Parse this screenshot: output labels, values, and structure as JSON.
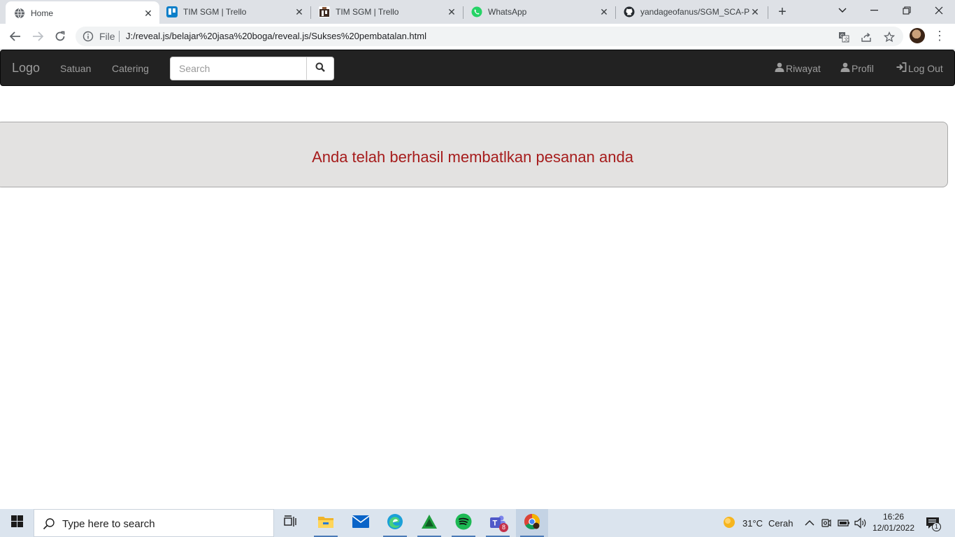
{
  "browser": {
    "tabs": [
      {
        "title": "Home",
        "icon": "globe-icon",
        "active": true
      },
      {
        "title": "TIM SGM | Trello",
        "icon": "trello-icon",
        "active": false
      },
      {
        "title": "TIM SGM | Trello",
        "icon": "trello-icon",
        "active": false
      },
      {
        "title": "WhatsApp",
        "icon": "whatsapp-icon",
        "active": false
      },
      {
        "title": "yandageofanus/SGM_SCA-Pa",
        "icon": "github-icon",
        "active": false
      }
    ],
    "address": {
      "scheme_label": "File",
      "url": "J:/reveal.js/belajar%20jasa%20boga/reveal.js/Sukses%20pembatalan.html"
    }
  },
  "navbar": {
    "brand": "Logo",
    "links": [
      "Satuan",
      "Catering"
    ],
    "search": {
      "placeholder": "Search",
      "value": ""
    },
    "right": [
      {
        "label": "Riwayat",
        "icon": "user-icon"
      },
      {
        "label": " Profil",
        "icon": "user-icon"
      },
      {
        "label": "Log Out",
        "icon": "log-in-icon"
      }
    ],
    "bg_color": "#222222"
  },
  "main": {
    "message": "Anda telah berhasil membatlkan pesanan anda",
    "message_color": "#a61c1c",
    "panel_color": "#e3e2e1"
  },
  "taskbar": {
    "search_placeholder": "Type here to search",
    "weather": {
      "temp": "31°C",
      "condition": "Cerah"
    },
    "clock": {
      "time": "16:26",
      "date": "12/01/2022"
    },
    "notification_count": "1",
    "teams_badge": "8"
  }
}
